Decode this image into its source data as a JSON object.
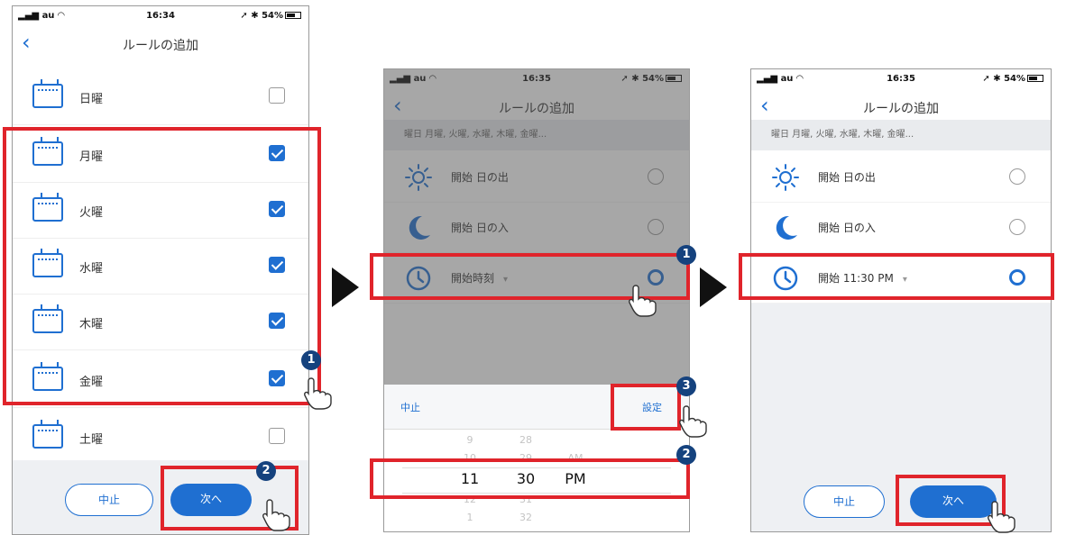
{
  "status": {
    "carrier": "au",
    "time1": "16:34",
    "time2": "16:35",
    "time3": "16:35",
    "battery": "54%"
  },
  "screen_title": "ルールの追加",
  "days": [
    {
      "label": "日曜",
      "checked": false
    },
    {
      "label": "月曜",
      "checked": true
    },
    {
      "label": "火曜",
      "checked": true
    },
    {
      "label": "水曜",
      "checked": true
    },
    {
      "label": "木曜",
      "checked": true
    },
    {
      "label": "金曜",
      "checked": true
    },
    {
      "label": "土曜",
      "checked": false
    }
  ],
  "buttons": {
    "cancel": "中止",
    "next": "次へ",
    "set": "設定"
  },
  "rule_summary": "曜日 月曜, 火曜, 水曜, 木曜, 金曜...",
  "start_options": {
    "sunrise": "開始 日の出",
    "sunset": "開始 日の入",
    "time": "開始時刻",
    "time_set": "開始 11:30 PM"
  },
  "picker": {
    "hour_above": "9",
    "hour_prev": "10",
    "hour_sel": "11",
    "hour_next": "12",
    "hour_below": "1",
    "min_above": "28",
    "min_prev": "29",
    "min_sel": "30",
    "min_next": "31",
    "min_below": "32",
    "ampm_prev": "AM",
    "ampm_sel": "PM"
  },
  "steps": [
    "1",
    "2",
    "3"
  ],
  "colors": {
    "accent": "#1f6fd1",
    "highlight": "#e0242b",
    "badge": "#15427e"
  }
}
